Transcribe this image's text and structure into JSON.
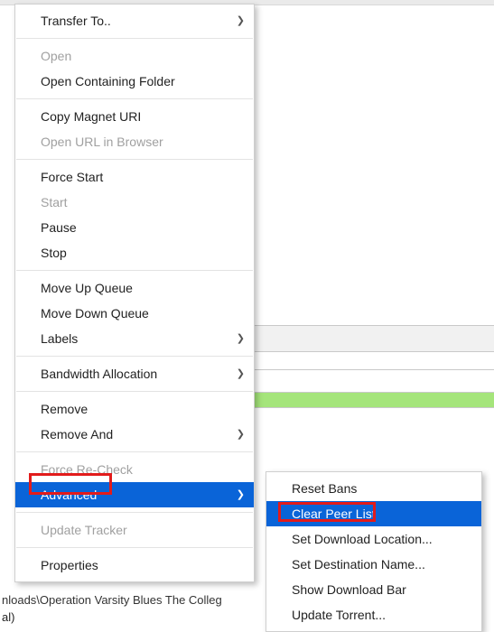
{
  "background": {
    "path_fragment": "nloads\\Operation Varsity Blues The Colleg",
    "path_fragment2": "al)"
  },
  "main_menu": {
    "transfer_to": "Transfer To..",
    "open": "Open",
    "open_containing": "Open Containing Folder",
    "copy_magnet": "Copy Magnet URI",
    "open_url": "Open URL in Browser",
    "force_start": "Force Start",
    "start": "Start",
    "pause": "Pause",
    "stop": "Stop",
    "move_up": "Move Up Queue",
    "move_down": "Move Down Queue",
    "labels": "Labels",
    "bandwidth": "Bandwidth Allocation",
    "remove": "Remove",
    "remove_and": "Remove And",
    "force_recheck": "Force Re-Check",
    "advanced": "Advanced",
    "update_tracker": "Update Tracker",
    "properties": "Properties"
  },
  "sub_menu": {
    "reset_bans": "Reset Bans",
    "clear_peer": "Clear Peer List",
    "set_dl_loc": "Set Download Location...",
    "set_dest": "Set Destination Name...",
    "show_dl_bar": "Show Download Bar",
    "update_torrent": "Update Torrent..."
  }
}
